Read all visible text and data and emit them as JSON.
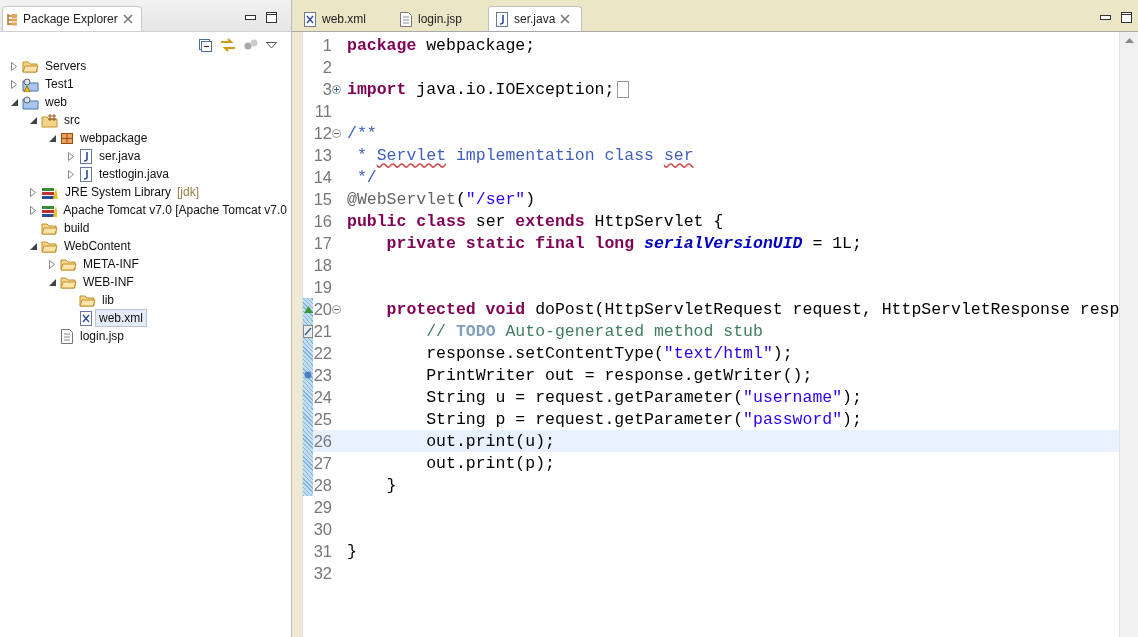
{
  "explorer": {
    "title": "Package Explorer",
    "tree": [
      {
        "label": "Servers",
        "kind": "folder",
        "expanded": false,
        "selected": false
      },
      {
        "label": "Test1",
        "kind": "project-warning",
        "expanded": false,
        "selected": false
      },
      {
        "label": "web",
        "kind": "project",
        "expanded": true,
        "selected": false,
        "children": [
          {
            "label": "src",
            "kind": "source-folder",
            "expanded": true,
            "selected": false,
            "children": [
              {
                "label": "webpackage",
                "kind": "package",
                "expanded": true,
                "selected": false,
                "children": [
                  {
                    "label": "ser.java",
                    "kind": "java",
                    "expanded": false,
                    "selected": false
                  },
                  {
                    "label": "testlogin.java",
                    "kind": "java",
                    "expanded": false,
                    "selected": false
                  }
                ]
              }
            ]
          },
          {
            "label": "JRE System Library",
            "decoration": "[jdk]",
            "kind": "library",
            "expanded": false,
            "selected": false
          },
          {
            "label": "Apache Tomcat v7.0 [Apache Tomcat v7.0",
            "kind": "library",
            "expanded": false,
            "selected": false
          },
          {
            "label": "build",
            "kind": "folder",
            "selected": false
          },
          {
            "label": "WebContent",
            "kind": "folder",
            "expanded": true,
            "selected": false,
            "children": [
              {
                "label": "META-INF",
                "kind": "folder",
                "expanded": false,
                "selected": false
              },
              {
                "label": "WEB-INF",
                "kind": "folder",
                "expanded": true,
                "selected": false,
                "children": [
                  {
                    "label": "lib",
                    "kind": "folder",
                    "selected": false
                  },
                  {
                    "label": "web.xml",
                    "kind": "xml",
                    "selected": true
                  }
                ]
              },
              {
                "label": "login.jsp",
                "kind": "jsp",
                "selected": false
              }
            ]
          }
        ]
      }
    ]
  },
  "editor": {
    "tabs": [
      {
        "label": "web.xml",
        "kind": "xml",
        "selected": false
      },
      {
        "label": "login.jsp",
        "kind": "jsp",
        "selected": false
      },
      {
        "label": "ser.java",
        "kind": "java",
        "selected": true
      }
    ],
    "lines": [
      {
        "number": "1",
        "tokens": [
          {
            "kind": "keyword",
            "text": "package"
          },
          {
            "kind": "plain",
            "text": " webpackage;"
          }
        ]
      },
      {
        "number": "2"
      },
      {
        "number": "3",
        "fold": {
          "collapsed": true
        },
        "tokens": [
          {
            "kind": "keyword",
            "text": "import"
          },
          {
            "kind": "plain",
            "text": " java.io.IOException;"
          }
        ]
      },
      {
        "number": "11"
      },
      {
        "number": "12",
        "fold": {
          "collapsed": false
        },
        "tokens": [
          {
            "kind": "javadoc",
            "text": "/**"
          }
        ]
      },
      {
        "number": "13",
        "tokens": [
          {
            "kind": "javadoc",
            "text": " * "
          },
          {
            "kind": "javadoc",
            "text": "Servlet",
            "misspelled": true
          },
          {
            "kind": "javadoc",
            "text": " implementation class "
          },
          {
            "kind": "javadoc",
            "text": "ser",
            "misspelled": true
          }
        ]
      },
      {
        "number": "14",
        "tokens": [
          {
            "kind": "javadoc",
            "text": " */"
          }
        ]
      },
      {
        "number": "15",
        "tokens": [
          {
            "kind": "annotation",
            "text": "@WebServlet"
          },
          {
            "kind": "plain",
            "text": "("
          },
          {
            "kind": "string",
            "text": "\"/ser\""
          },
          {
            "kind": "plain",
            "text": ")"
          }
        ]
      },
      {
        "number": "16",
        "tokens": [
          {
            "kind": "keyword",
            "text": "public class"
          },
          {
            "kind": "plain",
            "text": " ser "
          },
          {
            "kind": "keyword",
            "text": "extends"
          },
          {
            "kind": "plain",
            "text": " HttpServlet {"
          }
        ]
      },
      {
        "number": "17",
        "tokens": [
          {
            "kind": "keyword",
            "text": "    private static final long"
          },
          {
            "kind": "field",
            "text": " serialVersionUID"
          },
          {
            "kind": "plain",
            "text": " = 1L;"
          }
        ]
      },
      {
        "number": "18"
      },
      {
        "number": "19"
      },
      {
        "number": "20",
        "fold": {
          "collapsed": false
        },
        "marker": {
          "kind": "override"
        },
        "changed": true,
        "tokens": [
          {
            "kind": "keyword",
            "text": "    protected void"
          },
          {
            "kind": "plain",
            "text": " doPost(HttpServletRequest request, HttpServletResponse resp"
          }
        ]
      },
      {
        "number": "21",
        "marker": {
          "kind": "task"
        },
        "changed": true,
        "tokens": [
          {
            "kind": "comment",
            "text": "        // "
          },
          {
            "kind": "todo",
            "text": "TODO"
          },
          {
            "kind": "comment",
            "text": " Auto-generated method stub"
          }
        ]
      },
      {
        "number": "22",
        "changed": true,
        "tokens": [
          {
            "kind": "plain",
            "text": "        response.setContentType("
          },
          {
            "kind": "string",
            "text": "\"text/html\""
          },
          {
            "kind": "plain",
            "text": ");"
          }
        ]
      },
      {
        "number": "23",
        "marker": {
          "kind": "occurrence"
        },
        "changed": true,
        "tokens": [
          {
            "kind": "plain",
            "text": "        PrintWriter out = response.getWriter();"
          }
        ]
      },
      {
        "number": "24",
        "changed": true,
        "tokens": [
          {
            "kind": "plain",
            "text": "        String u = request.getParameter("
          },
          {
            "kind": "string",
            "text": "\"username\""
          },
          {
            "kind": "plain",
            "text": ");"
          }
        ]
      },
      {
        "number": "25",
        "changed": true,
        "tokens": [
          {
            "kind": "plain",
            "text": "        String p = request.getParameter("
          },
          {
            "kind": "string",
            "text": "\"password\""
          },
          {
            "kind": "plain",
            "text": ");"
          }
        ]
      },
      {
        "number": "26",
        "changed": true,
        "current": true,
        "tokens": [
          {
            "kind": "plain",
            "text": "        out.print(u);"
          }
        ]
      },
      {
        "number": "27",
        "changed": true,
        "tokens": [
          {
            "kind": "plain",
            "text": "        out.print(p);"
          }
        ]
      },
      {
        "number": "28",
        "changed": true,
        "tokens": [
          {
            "kind": "plain",
            "text": "    }"
          }
        ]
      },
      {
        "number": "29"
      },
      {
        "number": "30"
      },
      {
        "number": "31",
        "tokens": [
          {
            "kind": "plain",
            "text": "}"
          }
        ]
      },
      {
        "number": "32"
      }
    ]
  }
}
